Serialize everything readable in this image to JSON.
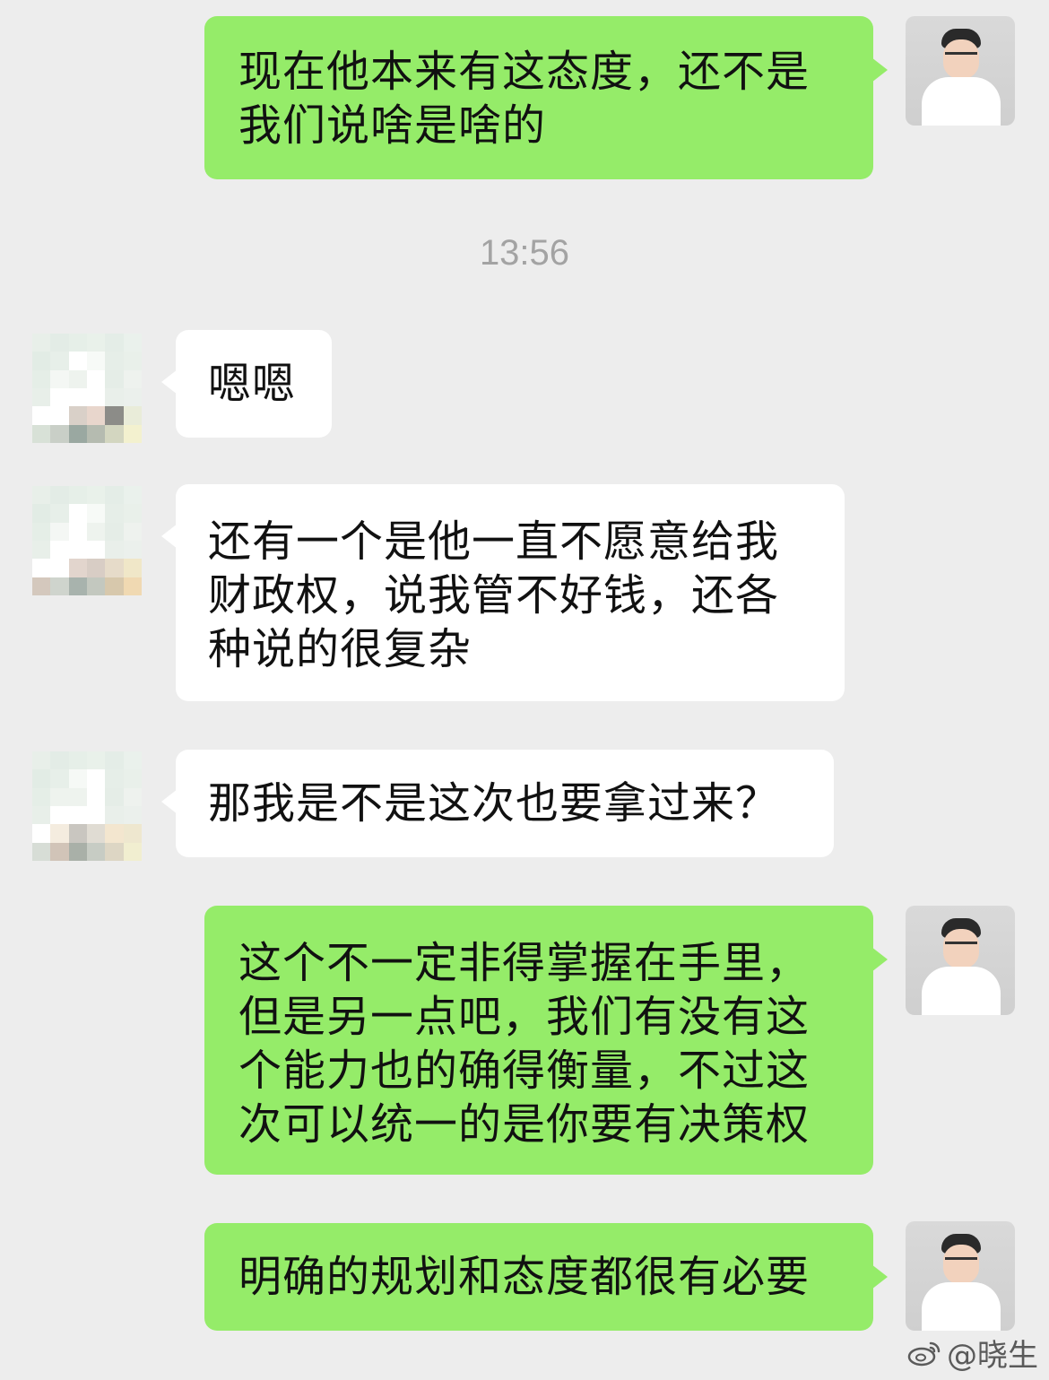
{
  "conversation": {
    "timestamp": "13:56",
    "messages": [
      {
        "side": "right",
        "text": "现在他本来有这态度，还不是我们说啥是啥的"
      },
      {
        "side": "left",
        "text": "嗯嗯"
      },
      {
        "side": "left",
        "text": "还有一个是他一直不愿意给我财政权，说我管不好钱，还各种说的很复杂"
      },
      {
        "side": "left",
        "text": "那我是不是这次也要拿过来？"
      },
      {
        "side": "right",
        "text": "这个不一定非得掌握在手里，但是另一点吧，我们有没有这个能力也的确得衡量，不过这次可以统一的是你要有决策权"
      },
      {
        "side": "right",
        "text": "明确的规划和态度都很有必要"
      }
    ]
  },
  "watermark": {
    "icon": "weibo-icon",
    "text": "@晓生"
  },
  "colors": {
    "background": "#ededed",
    "outgoing_bubble": "#95ec69",
    "incoming_bubble": "#ffffff",
    "text": "#111111",
    "timestamp": "#a3a3a3"
  }
}
